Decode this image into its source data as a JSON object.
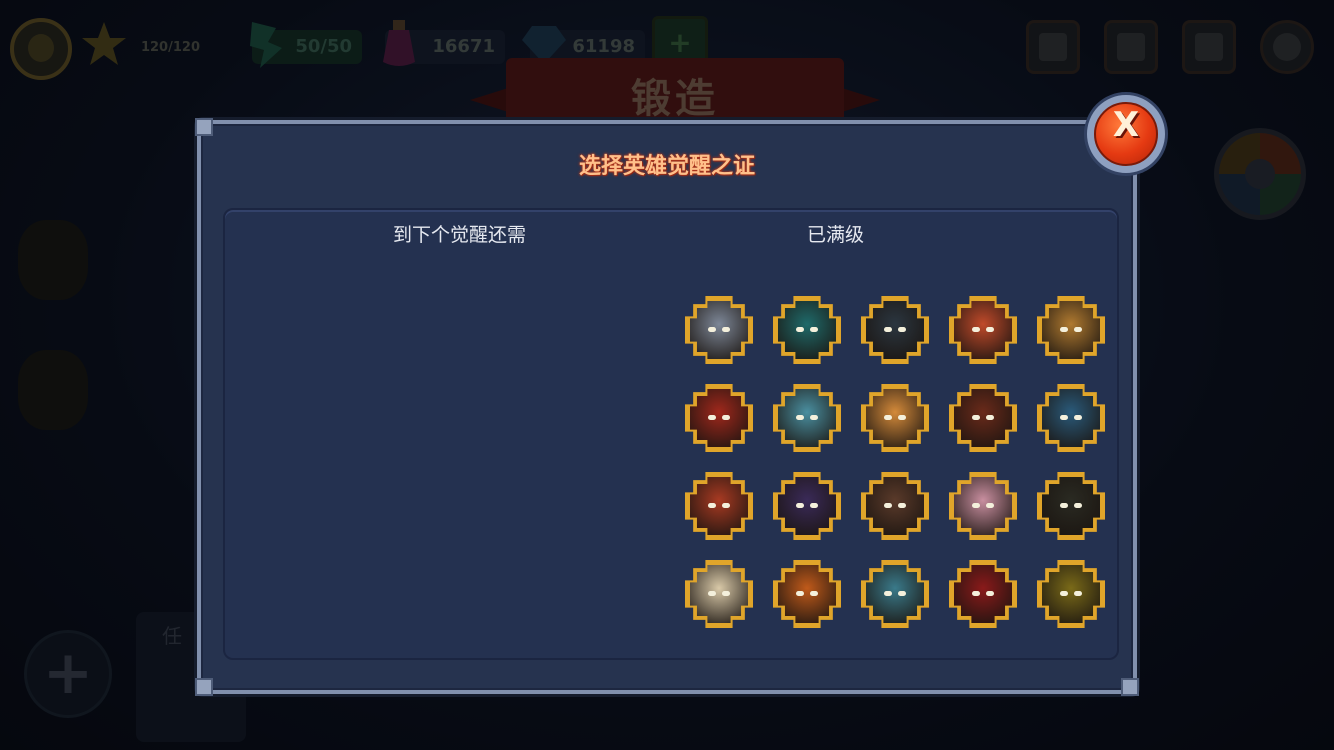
{
  "background": {
    "forge_title": "锻造",
    "bottom_tab_labels": [
      "任",
      ""
    ],
    "resources": {
      "star": "120/120",
      "stamina": "50/50",
      "potion": "16671",
      "gem": "61198"
    },
    "top_icons": [
      "book-icon",
      "vip-icon",
      "mail-icon",
      "gear-icon"
    ]
  },
  "modal": {
    "title": "选择英雄觉醒之证",
    "col_left_label": "到下个觉醒还需",
    "col_right_label": "已满级",
    "close_label": "X"
  },
  "heroes": [
    {
      "id": "hero-1",
      "color": "#7d8797"
    },
    {
      "id": "hero-2",
      "color": "#1f6a6a"
    },
    {
      "id": "hero-3",
      "color": "#2b3640"
    },
    {
      "id": "hero-4",
      "color": "#c04a2a"
    },
    {
      "id": "hero-5",
      "color": "#b07a30"
    },
    {
      "id": "hero-6",
      "color": "#a0281c"
    },
    {
      "id": "hero-7",
      "color": "#4a8fa0"
    },
    {
      "id": "hero-8",
      "color": "#d48a3a"
    },
    {
      "id": "hero-9",
      "color": "#6a2a1a"
    },
    {
      "id": "hero-10",
      "color": "#2a5a7a"
    },
    {
      "id": "hero-11",
      "color": "#a83a22"
    },
    {
      "id": "hero-12",
      "color": "#3a2a58"
    },
    {
      "id": "hero-13",
      "color": "#5a3a2a"
    },
    {
      "id": "hero-14",
      "color": "#c98fa0"
    },
    {
      "id": "hero-15",
      "color": "#2a2a22"
    },
    {
      "id": "hero-16",
      "color": "#d9c9a8"
    },
    {
      "id": "hero-17",
      "color": "#c05a1a"
    },
    {
      "id": "hero-18",
      "color": "#3a7a8a"
    },
    {
      "id": "hero-19",
      "color": "#8a1a1a"
    },
    {
      "id": "hero-20",
      "color": "#7a6a18"
    }
  ],
  "colors": {
    "title_text": "#ffc08a",
    "frame_gold": "#e0a52a",
    "close_red": "#e53a12"
  }
}
